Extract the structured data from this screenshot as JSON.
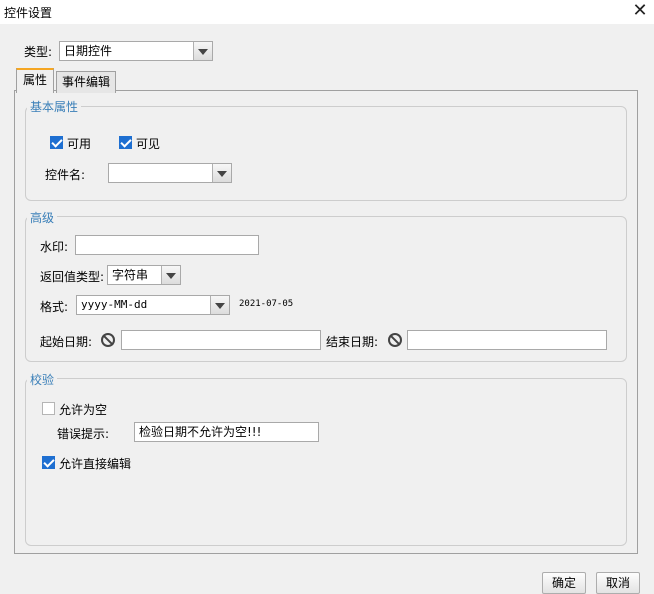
{
  "window": {
    "title": "控件设置"
  },
  "type_row": {
    "label": "类型:",
    "value": "日期控件"
  },
  "tabs": [
    {
      "label": "属性"
    },
    {
      "label": "事件编辑"
    }
  ],
  "basic": {
    "title": "基本属性",
    "enabled": {
      "label": "可用",
      "checked": true
    },
    "visible": {
      "label": "可见",
      "checked": true
    },
    "control_name": {
      "label": "控件名:",
      "value": ""
    }
  },
  "advanced": {
    "title": "高级",
    "watermark": {
      "label": "水印:",
      "value": ""
    },
    "return_type": {
      "label": "返回值类型:",
      "value": "字符串"
    },
    "format": {
      "label": "格式:",
      "value": "yyyy-MM-dd",
      "preview": "2021-07-05"
    },
    "start_date": {
      "label": "起始日期:",
      "value": ""
    },
    "end_date": {
      "label": "结束日期:",
      "value": ""
    }
  },
  "validation": {
    "title": "校验",
    "allow_empty": {
      "label": "允许为空",
      "checked": false
    },
    "error_hint": {
      "label": "错误提示:",
      "value": "检验日期不允许为空!!!"
    },
    "allow_direct_edit": {
      "label": "允许直接编辑",
      "checked": true
    }
  },
  "buttons": {
    "ok": "确定",
    "cancel": "取消"
  }
}
